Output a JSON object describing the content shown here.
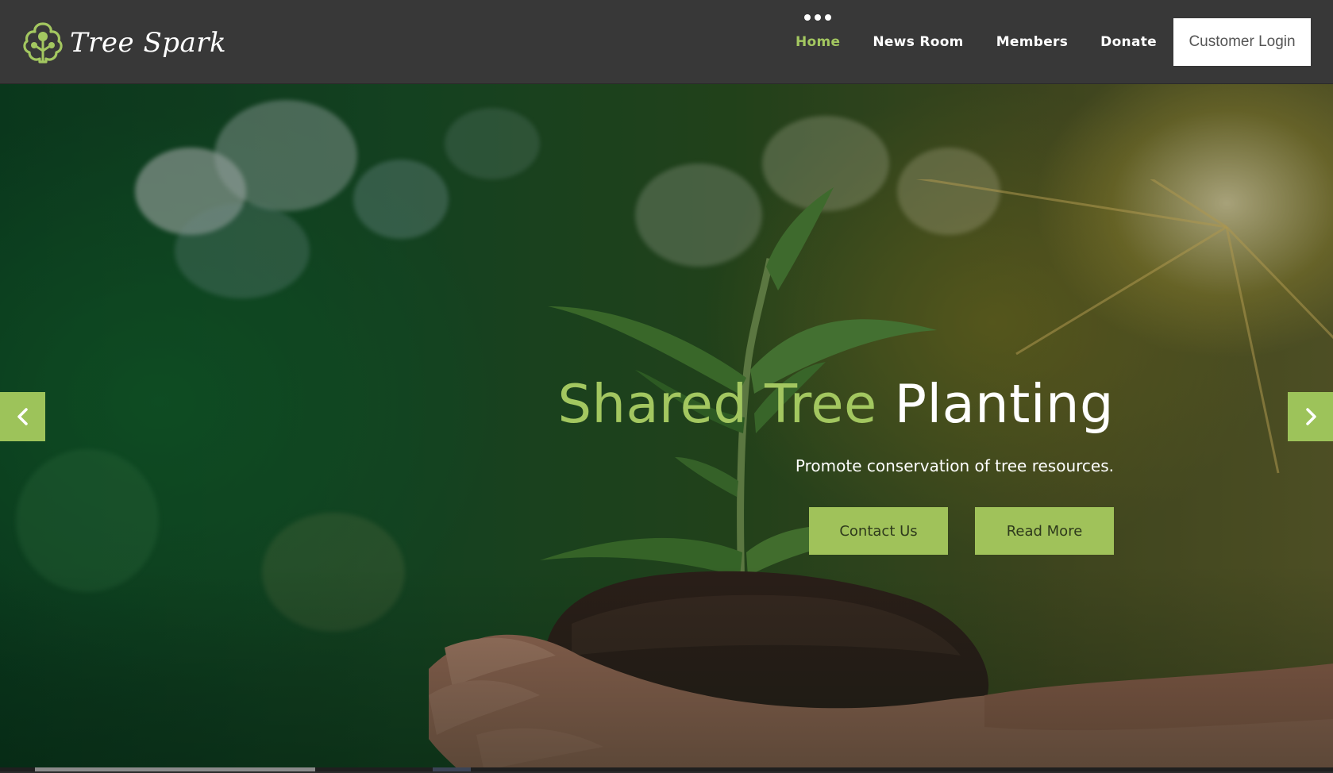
{
  "brand": {
    "name": "Tree Spark",
    "logo_icon": "tree-icon",
    "accent_color": "#a3c760"
  },
  "nav": {
    "items": [
      {
        "label": "Home",
        "active": true
      },
      {
        "label": "News Room",
        "active": false
      },
      {
        "label": "Members",
        "active": false
      },
      {
        "label": "Donate",
        "active": false
      }
    ],
    "login_label": "Customer Login",
    "active_indicator_icon": "dots-icon"
  },
  "hero": {
    "title_green": "Shared Tree",
    "title_white": "Planting",
    "subtitle": "Promote conservation of tree resources.",
    "buttons": {
      "contact": "Contact Us",
      "read_more": "Read More"
    },
    "prev_icon": "chevron-left-icon",
    "next_icon": "chevron-right-icon",
    "button_color": "#a0c25a",
    "slide_progress": 0.21
  }
}
